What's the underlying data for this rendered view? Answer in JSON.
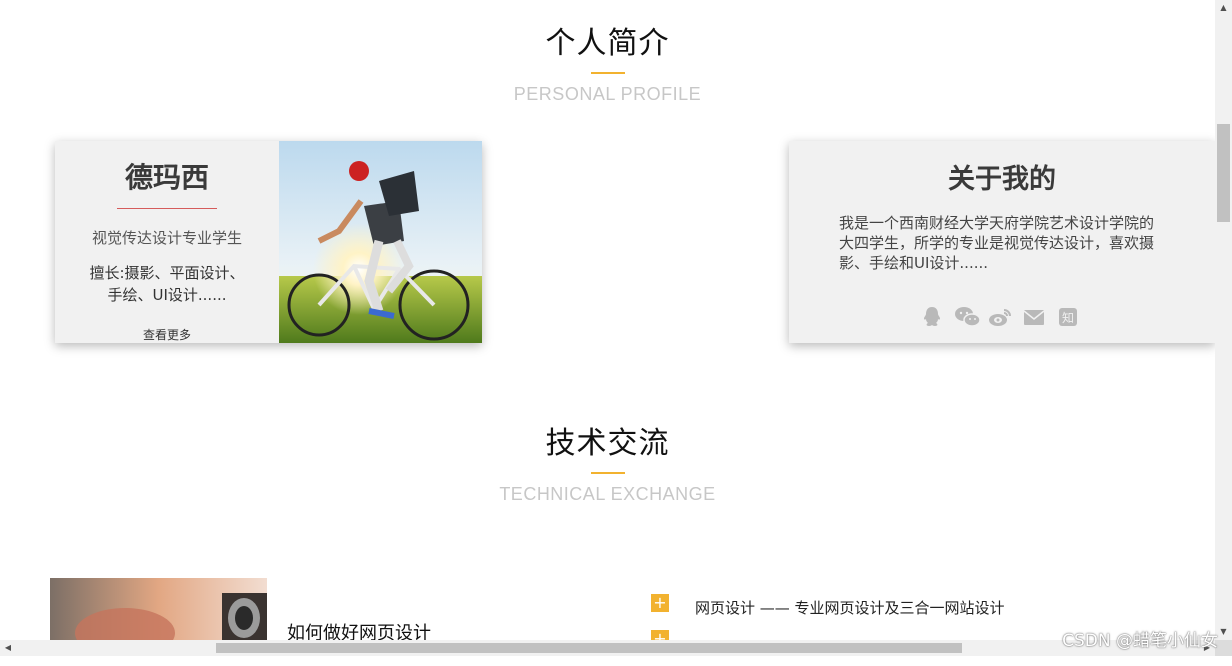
{
  "profile_section": {
    "title": "个人简介",
    "subtitle": "PERSONAL PROFILE"
  },
  "profile_card": {
    "name": "德玛西",
    "major": "视觉传达设计专业学生",
    "skills": "擅长:摄影、平面设计、手绘、UI设计......",
    "more_label": "查看更多"
  },
  "about_card": {
    "title": "关于我的",
    "description": "我是一个西南财经大学天府学院艺术设计学院的大四学生，所学的专业是视觉传达设计，喜欢摄影、手绘和UI设计......",
    "icons": [
      "qq-icon",
      "wechat-icon",
      "weibo-icon",
      "mail-icon",
      "zhihu-icon"
    ]
  },
  "tech_section": {
    "title": "技术交流",
    "subtitle": "TECHNICAL EXCHANGE"
  },
  "article": {
    "title": "如何做好网页设计"
  },
  "tech_list": [
    {
      "icon": "+",
      "text": "网页设计 —— 专业网页设计及三合一网站设计"
    },
    {
      "icon": "+",
      "text": ""
    }
  ],
  "watermark": "CSDN @蜡笔小仙女",
  "colors": {
    "accent": "#f2b22f",
    "name_underline": "#d55b5b",
    "card_bg": "#f1f1f1",
    "subtitle": "#c7c7c7"
  }
}
